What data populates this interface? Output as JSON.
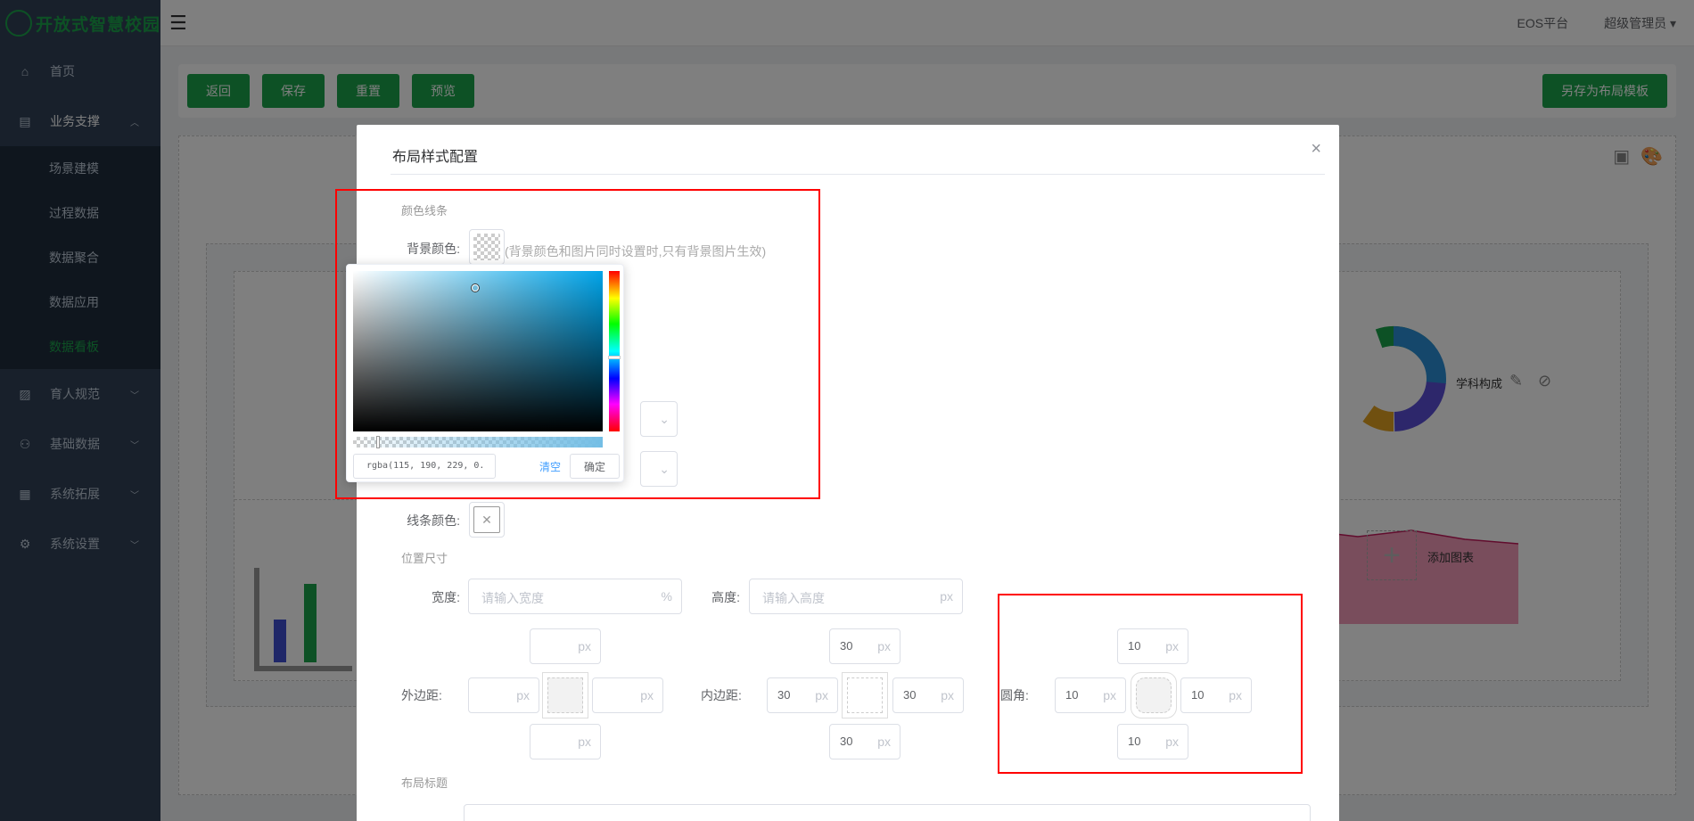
{
  "app": {
    "logo_text": "开放式智慧校园",
    "platform_label": "EOS平台",
    "user_label": "超级管理员"
  },
  "sidebar": {
    "items": [
      {
        "label": "首页",
        "icon": "home-icon"
      },
      {
        "label": "业务支撑",
        "icon": "layout-icon",
        "expanded": true
      },
      {
        "label": "育人规范",
        "icon": "image-icon"
      },
      {
        "label": "基础数据",
        "icon": "hierarchy-icon"
      },
      {
        "label": "系统拓展",
        "icon": "apps-icon"
      },
      {
        "label": "系统设置",
        "icon": "settings-icon"
      }
    ],
    "subitems": [
      {
        "label": "场景建模"
      },
      {
        "label": "过程数据"
      },
      {
        "label": "数据聚合"
      },
      {
        "label": "数据应用"
      },
      {
        "label": "数据看板",
        "active": true
      }
    ]
  },
  "toolbar": {
    "back": "返回",
    "save": "保存",
    "reset": "重置",
    "preview": "预览",
    "save_as_template": "另存为布局模板"
  },
  "background": {
    "chart_label": "学科构成",
    "add_chart": "添加图表"
  },
  "dialog": {
    "title": "布局样式配置",
    "close": "×",
    "color_section": "颜色线条",
    "bg_color_label": "背景颜色:",
    "bg_color_hint": "(背景颜色和图片同时设置时,只有背景图片生效)",
    "line_color_label": "线条颜色:",
    "size_section": "位置尺寸",
    "width_label": "宽度:",
    "width_placeholder": "请输入宽度",
    "width_unit": "%",
    "height_label": "高度:",
    "height_placeholder": "请输入高度",
    "unit_px": "px",
    "margin_label": "外边距:",
    "padding_label": "内边距:",
    "radius_label": "圆角:",
    "padding": {
      "top": "30",
      "left": "30",
      "right": "30",
      "bottom": "30"
    },
    "radius": {
      "top": "10",
      "left": "10",
      "right": "10",
      "bottom": "10"
    },
    "title_section": "布局标题"
  },
  "picker": {
    "value": "rgba(115, 190, 229, 0.",
    "clear": "清空",
    "confirm": "确定",
    "alpha_level": 0.1,
    "hue_color": "#00a4e9"
  },
  "colors": {
    "accent": "#1aa34a",
    "sidebar_bg": "#304156",
    "annotation_red": "#ff0000"
  }
}
